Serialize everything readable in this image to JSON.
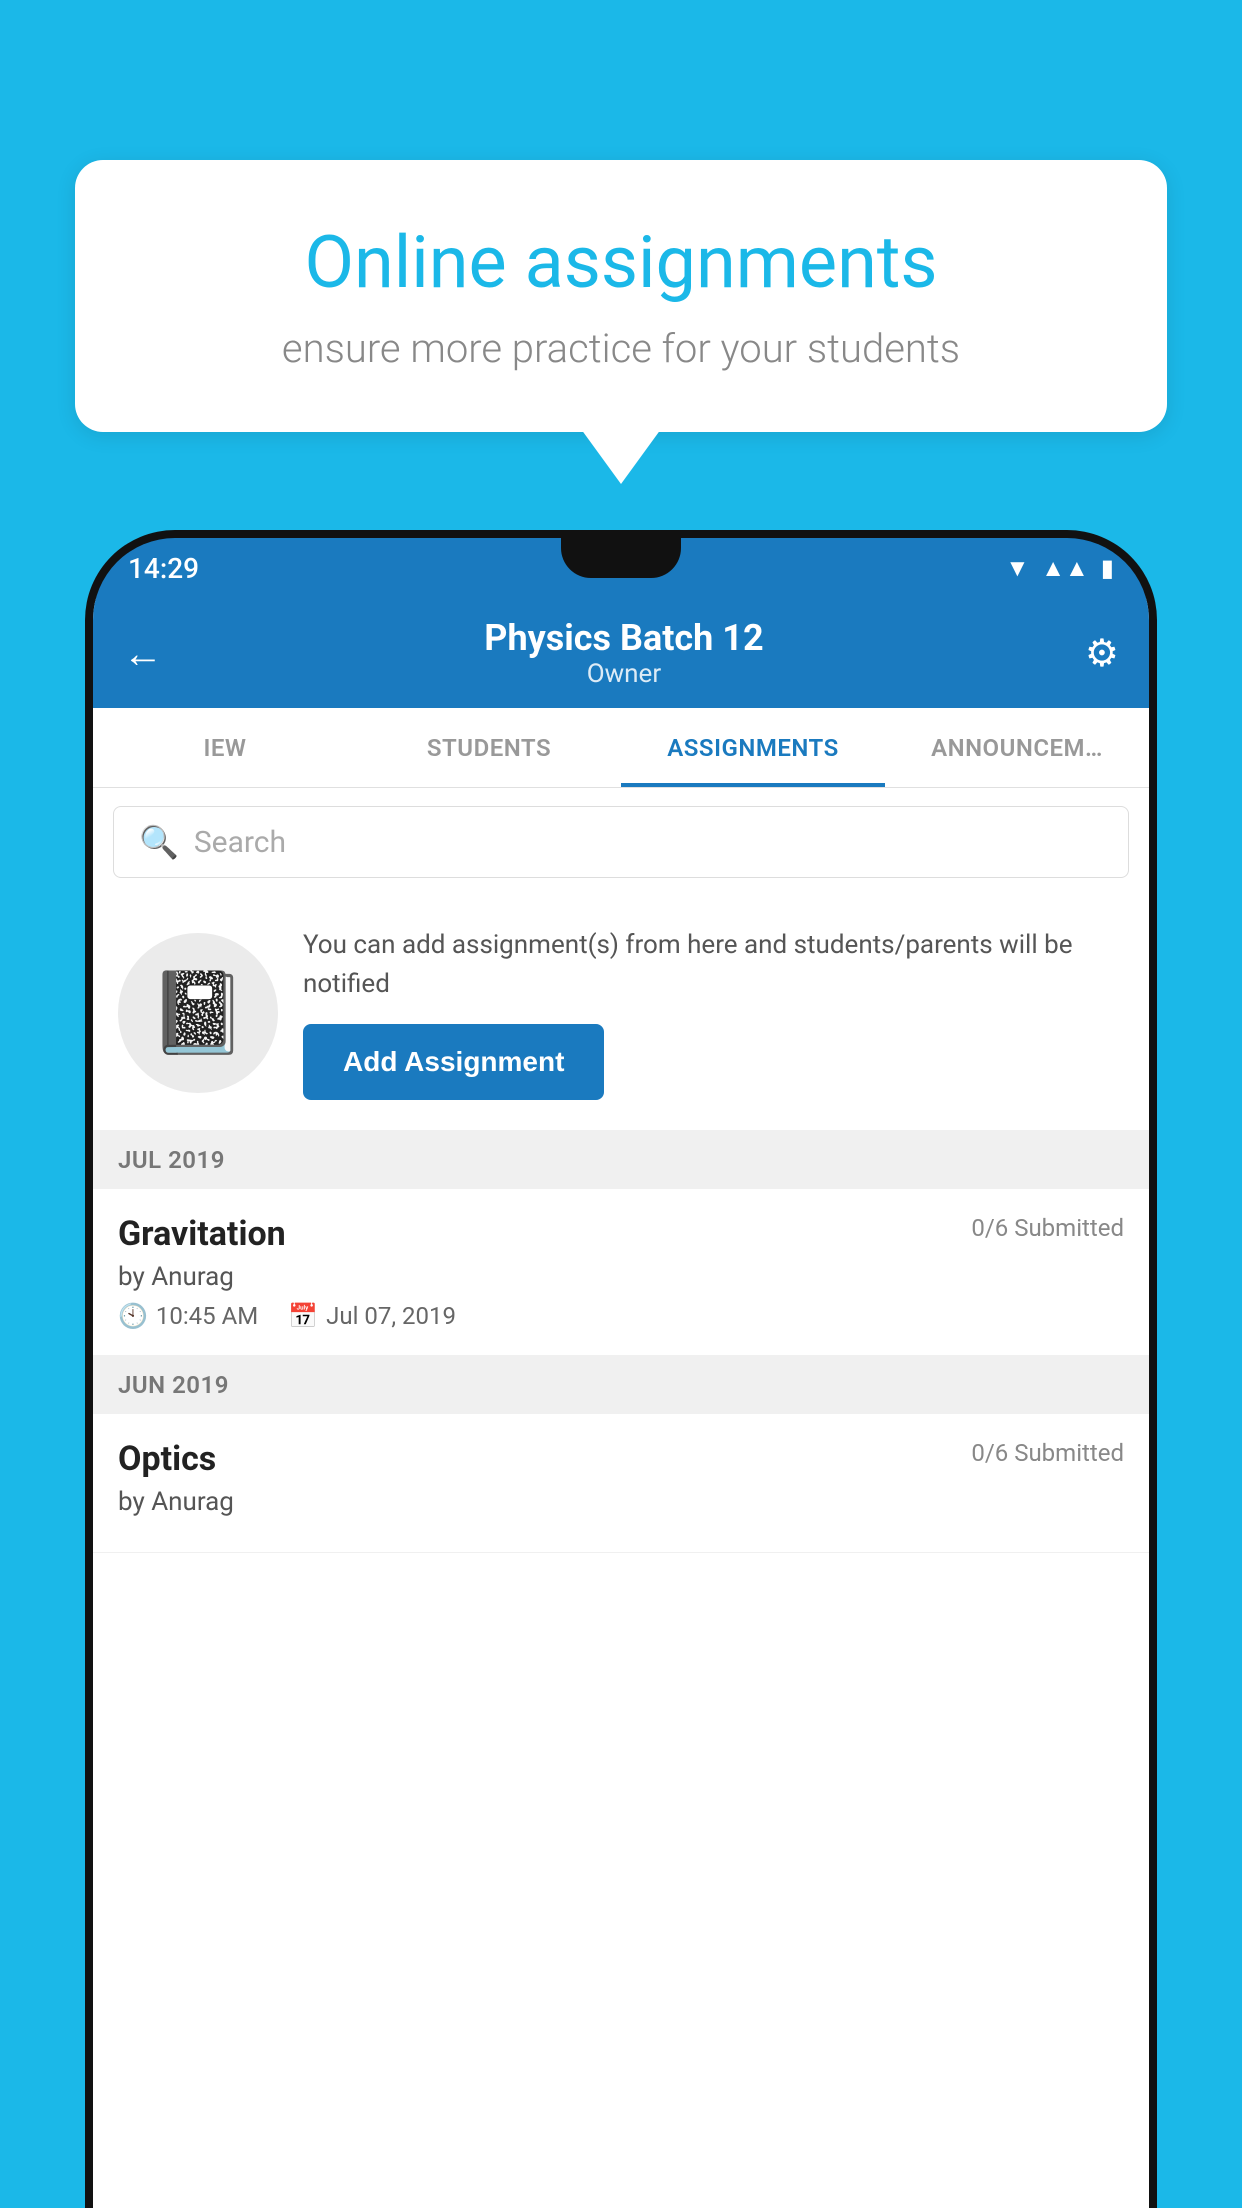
{
  "background_color": "#1bb8e8",
  "speech_bubble": {
    "title": "Online assignments",
    "subtitle": "ensure more practice for your students"
  },
  "status_bar": {
    "time": "14:29",
    "icons": [
      "wifi",
      "signal",
      "battery"
    ]
  },
  "app_bar": {
    "title": "Physics Batch 12",
    "subtitle": "Owner",
    "back_label": "←",
    "settings_label": "⚙"
  },
  "tabs": [
    {
      "label": "IEW",
      "active": false
    },
    {
      "label": "STUDENTS",
      "active": false
    },
    {
      "label": "ASSIGNMENTS",
      "active": true
    },
    {
      "label": "ANNOUNCEM…",
      "active": false
    }
  ],
  "search": {
    "placeholder": "Search"
  },
  "add_assignment": {
    "description": "You can add assignment(s) from here and students/parents will be notified",
    "button_label": "Add Assignment"
  },
  "sections": [
    {
      "header": "JUL 2019",
      "assignments": [
        {
          "name": "Gravitation",
          "submitted": "0/6 Submitted",
          "by": "by Anurag",
          "time": "10:45 AM",
          "date": "Jul 07, 2019"
        }
      ]
    },
    {
      "header": "JUN 2019",
      "assignments": [
        {
          "name": "Optics",
          "submitted": "0/6 Submitted",
          "by": "by Anurag",
          "time": "",
          "date": ""
        }
      ]
    }
  ]
}
